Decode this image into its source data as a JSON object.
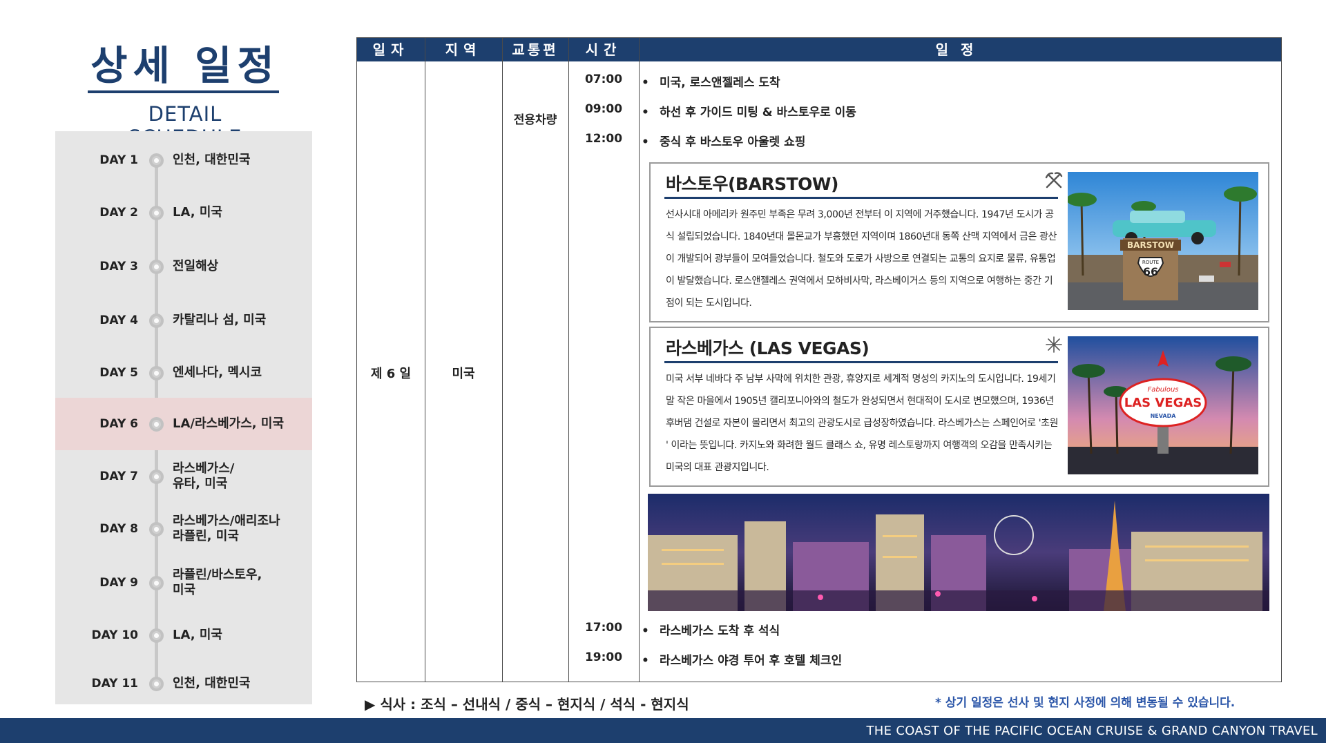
{
  "title": {
    "korean": "상세 일정",
    "english": "DETAIL SCHEDULE"
  },
  "days": [
    {
      "day": "DAY 1",
      "place": "인천, 대한민국"
    },
    {
      "day": "DAY 2",
      "place": "LA, 미국"
    },
    {
      "day": "DAY 3",
      "place": "전일해상"
    },
    {
      "day": "DAY 4",
      "place": "카탈리나 섬, 미국"
    },
    {
      "day": "DAY 5",
      "place": "엔세나다, 멕시코"
    },
    {
      "day": "DAY 6",
      "place": "LA/라스베가스, 미국"
    },
    {
      "day": "DAY 7",
      "place": "라스베가스/\n유타, 미국"
    },
    {
      "day": "DAY 8",
      "place": "라스베가스/애리조나\n라플린, 미국"
    },
    {
      "day": "DAY 9",
      "place": "라플린/바스토우,\n미국"
    },
    {
      "day": "DAY 10",
      "place": "LA, 미국"
    },
    {
      "day": "DAY 11",
      "place": "인천, 대한민국"
    }
  ],
  "table": {
    "headers": {
      "date": "일자",
      "region": "지역",
      "transport": "교통편",
      "time": "시간",
      "schedule": "일정"
    },
    "date": "제 6 일",
    "region": "미국",
    "transport": "전용차량",
    "rows": [
      {
        "time": "07:00",
        "text": "미국, 로스앤젤레스 도착"
      },
      {
        "time": "09:00",
        "text": "하선 후 가이드 미팅 & 바스토우로 이동"
      },
      {
        "time": "12:00",
        "text": "중식 후 바스토우 아울렛 쇼핑"
      },
      {
        "time": "17:00",
        "text": "라스베가스 도착 후 석식"
      },
      {
        "time": "19:00",
        "text": "라스베가스 야경 투어 후 호텔 체크인"
      }
    ],
    "bullet": "•"
  },
  "cards": {
    "barstow": {
      "title": "바스토우(BARSTOW)",
      "icon": "pickaxe-icon",
      "body": "선사시대 아메리카 원주민 부족은 무려 3,000년 전부터 이 지역에 거주했습니다. 1947년 도시가 공식 설립되었습니다. 1840년대 몰몬교가 부흥했던 지역이며 1860년대 동쪽 산맥 지역에서 금은 광산이 개발되어 광부들이 모여들었습니다. 철도와 도로가 사방으로 연결되는 교통의 요지로 물류, 유통업이 발달했습니다. 로스앤젤레스 권역에서 모하비사막, 라스베이거스 등의 지역으로 여행하는 중간 기점이 되는 도시입니다.",
      "photo_sign": "BARSTOW",
      "photo_route": "ROUTE",
      "photo_route_num": "66"
    },
    "lasvegas": {
      "title": "라스베가스 (LAS VEGAS)",
      "icon": "fireworks-icon",
      "body": "미국 서부 네바다 주 남부 사막에 위치한 관광, 휴양지로 세계적 명성의 카지노의 도시입니다. 19세기 말 작은 마을에서 1905년 캘리포니아와의 철도가 완성되면서 현대적이 도시로 변모했으며, 1936년 후버댐 건설로 자본이 몰리면서 최고의 관광도시로 급성장하였습니다. 라스베가스는 스페인어로 '초원 ' 이라는 뜻입니다. 카지노와 화려한 월드 클래스 쇼, 유명 레스토랑까지 여행객의 오감을 만족시키는 미국의 대표 관광지입니다.",
      "photo_sign_top": "Fabulous",
      "photo_sign_main": "LAS VEGAS",
      "photo_sign_bottom": "NEVADA"
    }
  },
  "meal": "▶ 식사 : 조식 – 선내식 / 중식 – 현지식 / 석식 - 현지식",
  "note": "* 상기 일정은 선사 및 현지 사정에 의해 변동될 수 있습니다.",
  "footer": "THE COAST OF THE PACIFIC OCEAN CRUISE & GRAND CANYON TRAVEL",
  "colors": {
    "navy": "#1d3f6e",
    "active_day": "#ecd6d6",
    "sidebar": "#e6e6e6",
    "note": "#2a55a8"
  }
}
